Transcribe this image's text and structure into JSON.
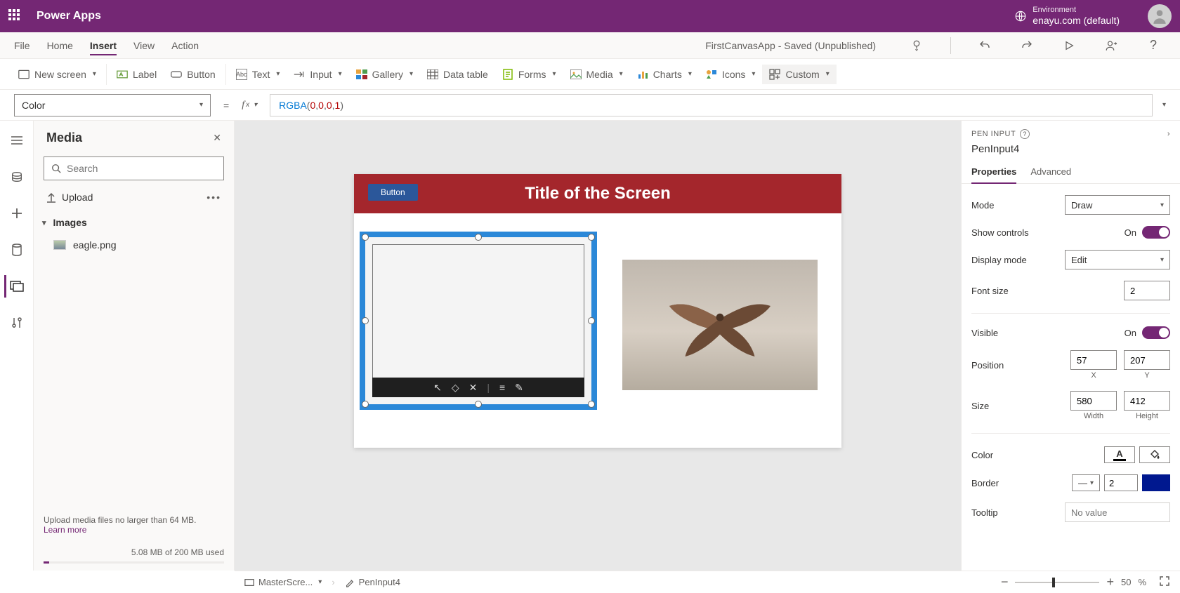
{
  "header": {
    "app_name": "Power Apps",
    "env_label": "Environment",
    "env_name": "enayu.com (default)"
  },
  "menu": {
    "items": [
      "File",
      "Home",
      "Insert",
      "View",
      "Action"
    ],
    "active": "Insert",
    "doc_title": "FirstCanvasApp - Saved (Unpublished)"
  },
  "ribbon": {
    "new_screen": "New screen",
    "label": "Label",
    "button": "Button",
    "text": "Text",
    "input": "Input",
    "gallery": "Gallery",
    "data_table": "Data table",
    "forms": "Forms",
    "media": "Media",
    "charts": "Charts",
    "icons": "Icons",
    "custom": "Custom"
  },
  "formula": {
    "property": "Color",
    "fn": "RGBA",
    "a1": "0",
    "a2": "0",
    "a3": "0",
    "a4": "1"
  },
  "media_panel": {
    "title": "Media",
    "search_ph": "Search",
    "upload": "Upload",
    "category": "Images",
    "files": [
      "eagle.png"
    ],
    "hint": "Upload media files no larger than 64 MB.",
    "learn": "Learn more",
    "usage": "5.08 MB of 200 MB used"
  },
  "canvas": {
    "screen_title": "Title of the Screen",
    "button_label": "Button"
  },
  "props": {
    "type_label": "PEN INPUT",
    "control_name": "PenInput4",
    "tabs": {
      "properties": "Properties",
      "advanced": "Advanced"
    },
    "mode": {
      "label": "Mode",
      "value": "Draw"
    },
    "show_controls": {
      "label": "Show controls",
      "value": "On"
    },
    "display_mode": {
      "label": "Display mode",
      "value": "Edit"
    },
    "font_size": {
      "label": "Font size",
      "value": "2"
    },
    "visible": {
      "label": "Visible",
      "value": "On"
    },
    "position": {
      "label": "Position",
      "x": "57",
      "y": "207",
      "xl": "X",
      "yl": "Y"
    },
    "size": {
      "label": "Size",
      "w": "580",
      "h": "412",
      "wl": "Width",
      "hl": "Height"
    },
    "color": {
      "label": "Color"
    },
    "border": {
      "label": "Border",
      "value": "2"
    },
    "tooltip": {
      "label": "Tooltip",
      "ph": "No value"
    }
  },
  "status": {
    "screen_name": "MasterScre...",
    "selected": "PenInput4",
    "zoom": "50",
    "zoom_unit": "%"
  }
}
